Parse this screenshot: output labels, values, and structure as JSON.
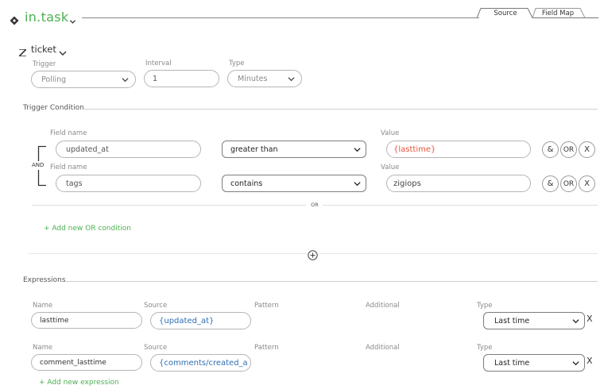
{
  "header": {
    "app_name": "in.task",
    "tabs": [
      {
        "label": "Source",
        "active": true
      },
      {
        "label": "Field Map",
        "active": false
      }
    ],
    "brand_color": "#4cb050"
  },
  "integration": {
    "name": "ticket",
    "trigger_label": "Trigger",
    "trigger_value": "Polling",
    "interval_label": "Interval",
    "interval_value": "1",
    "type_label": "Type",
    "type_value": "Minutes"
  },
  "trigger_condition": {
    "section_title": "Trigger Condition",
    "and_label": "AND",
    "or_label": "OR",
    "rows": [
      {
        "field_label": "Field name",
        "field_value": "updated_at",
        "operator": "greater than",
        "value_label": "Value",
        "value": "{lasttime}",
        "btn_and": "&",
        "btn_or": "OR",
        "btn_remove": "X"
      },
      {
        "field_label": "Field name",
        "field_value": "tags",
        "operator": "contains",
        "value_label": "Value",
        "value": "zigiops",
        "btn_and": "&",
        "btn_or": "OR",
        "btn_remove": "X"
      }
    ],
    "add_or_condition": "+ Add new OR condition",
    "value_color": "#e8553a"
  },
  "expressions": {
    "section_title": "Expressions",
    "rows": [
      {
        "name_label": "Name",
        "name": "lasttime",
        "source_label": "Source",
        "source": "{updated_at}",
        "pattern_label": "Pattern",
        "additional_label": "Additional",
        "type_label": "Type",
        "type": "Last time",
        "remove": "X"
      },
      {
        "name_label": "Name",
        "name": "comment_lasttime",
        "source_label": "Source",
        "source": "{comments/created_a",
        "pattern_label": "Pattern",
        "additional_label": "Additional",
        "type_label": "Type",
        "type": "Last time",
        "remove": "X"
      }
    ],
    "add_expression": "+ Add new expression",
    "source_color": "#2f6fb3"
  }
}
